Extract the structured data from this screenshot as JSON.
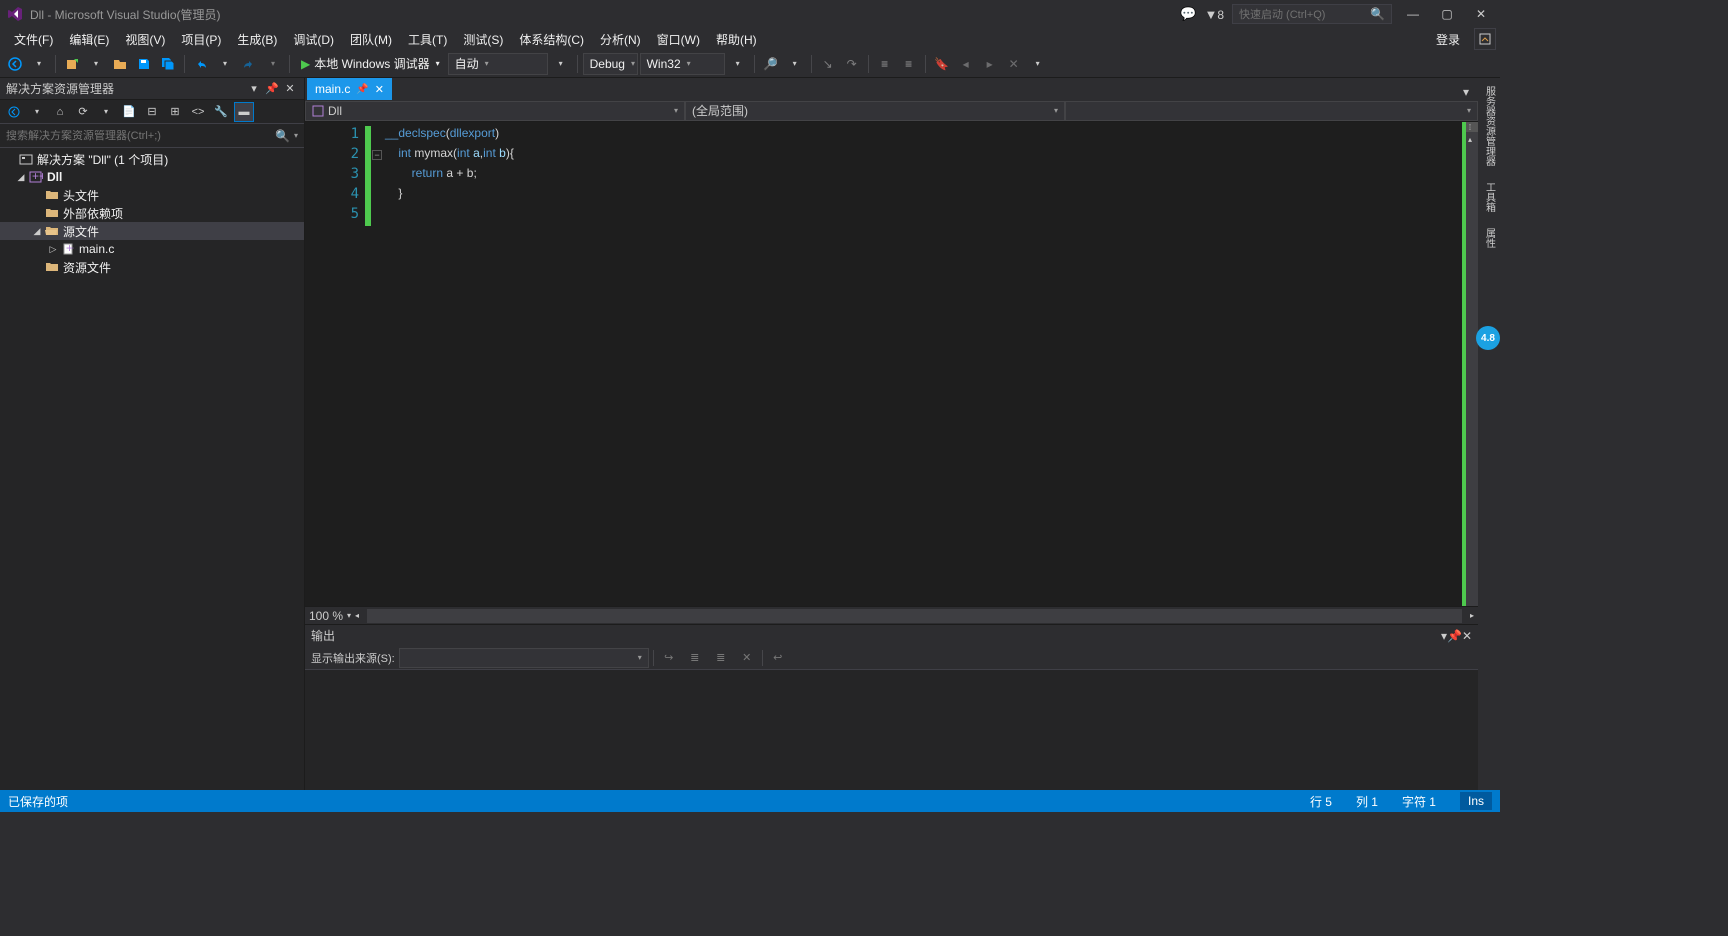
{
  "titlebar": {
    "title": "Dll - Microsoft Visual Studio(管理员)",
    "flag_count": "8",
    "search_placeholder": "快速启动 (Ctrl+Q)"
  },
  "menubar": {
    "items": [
      "文件(F)",
      "编辑(E)",
      "视图(V)",
      "项目(P)",
      "生成(B)",
      "调试(D)",
      "团队(M)",
      "工具(T)",
      "测试(S)",
      "体系结构(C)",
      "分析(N)",
      "窗口(W)",
      "帮助(H)"
    ],
    "login": "登录"
  },
  "toolbar": {
    "start_label": "本地 Windows 调试器",
    "startup_mode": "自动",
    "config": "Debug",
    "platform": "Win32"
  },
  "solution_explorer": {
    "title": "解决方案资源管理器",
    "search_placeholder": "搜索解决方案资源管理器(Ctrl+;)",
    "solution": "解决方案 \"Dll\" (1 个项目)",
    "project": "Dll",
    "folders": {
      "headers": "头文件",
      "external": "外部依赖项",
      "sources": "源文件",
      "resources": "资源文件"
    },
    "file": "main.c"
  },
  "editor": {
    "tab": "main.c",
    "nav_project": "Dll",
    "nav_scope": "(全局范围)",
    "lines": [
      "1",
      "2",
      "3",
      "4",
      "5"
    ],
    "code": {
      "l1_declspec": "__declspec",
      "l1_dllexport": "dllexport",
      "l2_int": "int",
      "l2_mymax": "mymax",
      "l2_inta": "int",
      "l2_a": "a",
      "l2_intb": "int",
      "l2_b": "b",
      "l3_return": "return",
      "l3_a": "a",
      "l3_plus": "+",
      "l3_b": "b"
    },
    "zoom": "100 %"
  },
  "output": {
    "title": "输出",
    "source_label": "显示输出来源(S):"
  },
  "right_tabs": {
    "t1": "服务器资源管理器",
    "t2": "工具箱",
    "t3": "属性",
    "badge": "4.8"
  },
  "statusbar": {
    "saved": "已保存的项",
    "line": "行 5",
    "col": "列 1",
    "char": "字符 1",
    "ins": "Ins"
  }
}
